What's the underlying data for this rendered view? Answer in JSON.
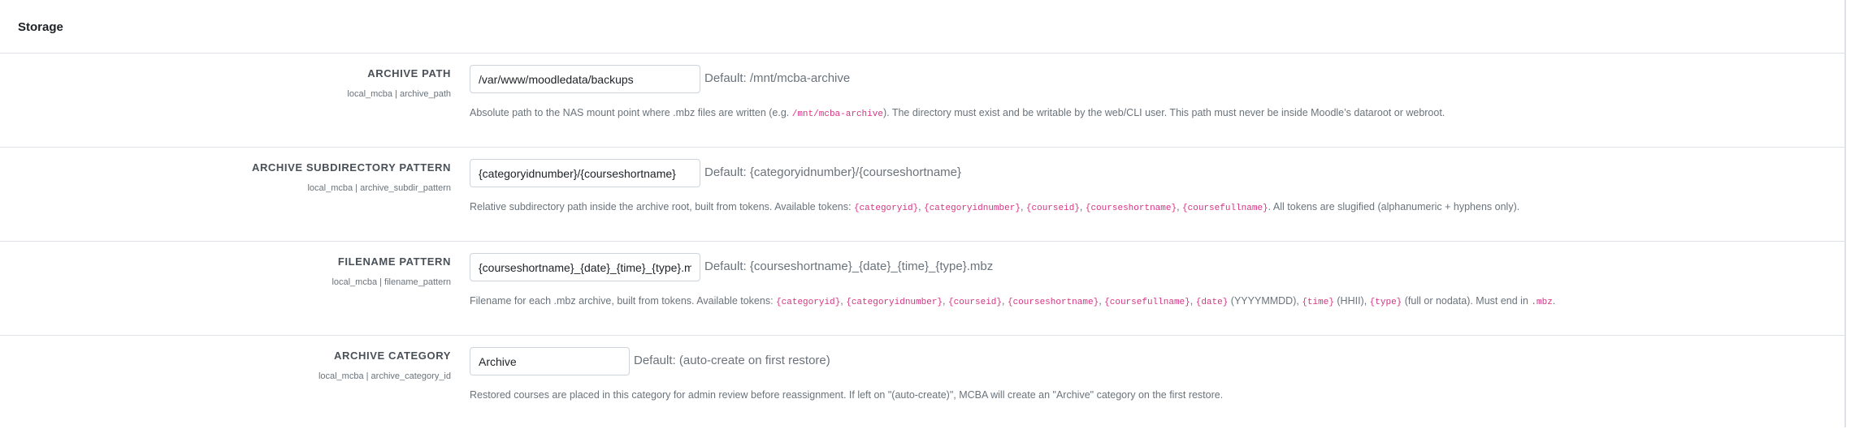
{
  "section": {
    "title": "Storage"
  },
  "settings": [
    {
      "name": "ARCHIVE PATH",
      "key": "local_mcba | archive_path",
      "value": "/var/www/moodledata/backups",
      "default": "Default: /mnt/mcba-archive",
      "desc": [
        {
          "t": "text",
          "v": "Absolute path to the NAS mount point where .mbz files are written (e.g. "
        },
        {
          "t": "code",
          "v": "/mnt/mcba-archive"
        },
        {
          "t": "text",
          "v": "). The directory must exist and be writable by the web/CLI user. This path must never be inside Moodle’s dataroot or webroot."
        }
      ]
    },
    {
      "name": "ARCHIVE SUBDIRECTORY PATTERN",
      "key": "local_mcba | archive_subdir_pattern",
      "value": "{categoryidnumber}/{courseshortname}",
      "default": "Default: {categoryidnumber}/{courseshortname}",
      "desc": [
        {
          "t": "text",
          "v": "Relative subdirectory path inside the archive root, built from tokens. Available tokens: "
        },
        {
          "t": "code",
          "v": "{categoryid}"
        },
        {
          "t": "text",
          "v": ", "
        },
        {
          "t": "code",
          "v": "{categoryidnumber}"
        },
        {
          "t": "text",
          "v": ", "
        },
        {
          "t": "code",
          "v": "{courseid}"
        },
        {
          "t": "text",
          "v": ", "
        },
        {
          "t": "code",
          "v": "{courseshortname}"
        },
        {
          "t": "text",
          "v": ", "
        },
        {
          "t": "code",
          "v": "{coursefullname}"
        },
        {
          "t": "text",
          "v": ". All tokens are slugified (alphanumeric + hyphens only)."
        }
      ]
    },
    {
      "name": "FILENAME PATTERN",
      "key": "local_mcba | filename_pattern",
      "value": "{courseshortname}_{date}_{time}_{type}.mbz",
      "default": "Default: {courseshortname}_{date}_{time}_{type}.mbz",
      "desc": [
        {
          "t": "text",
          "v": "Filename for each .mbz archive, built from tokens. Available tokens: "
        },
        {
          "t": "code",
          "v": "{categoryid}"
        },
        {
          "t": "text",
          "v": ", "
        },
        {
          "t": "code",
          "v": "{categoryidnumber}"
        },
        {
          "t": "text",
          "v": ", "
        },
        {
          "t": "code",
          "v": "{courseid}"
        },
        {
          "t": "text",
          "v": ", "
        },
        {
          "t": "code",
          "v": "{courseshortname}"
        },
        {
          "t": "text",
          "v": ", "
        },
        {
          "t": "code",
          "v": "{coursefullname}"
        },
        {
          "t": "text",
          "v": ", "
        },
        {
          "t": "code",
          "v": "{date}"
        },
        {
          "t": "text",
          "v": " (YYYYMMDD), "
        },
        {
          "t": "code",
          "v": "{time}"
        },
        {
          "t": "text",
          "v": " (HHII), "
        },
        {
          "t": "code",
          "v": "{type}"
        },
        {
          "t": "text",
          "v": " (full or nodata). Must end in "
        },
        {
          "t": "code",
          "v": ".mbz"
        },
        {
          "t": "text",
          "v": "."
        }
      ]
    },
    {
      "name": "ARCHIVE CATEGORY",
      "key": "local_mcba | archive_category_id",
      "value": "Archive",
      "default": "Default: (auto-create on first restore)",
      "desc": [
        {
          "t": "text",
          "v": "Restored courses are placed in this category for admin review before reassignment. If left on \"(auto-create)\", MCBA will create an \"Archive\" category on the first restore."
        }
      ]
    }
  ]
}
